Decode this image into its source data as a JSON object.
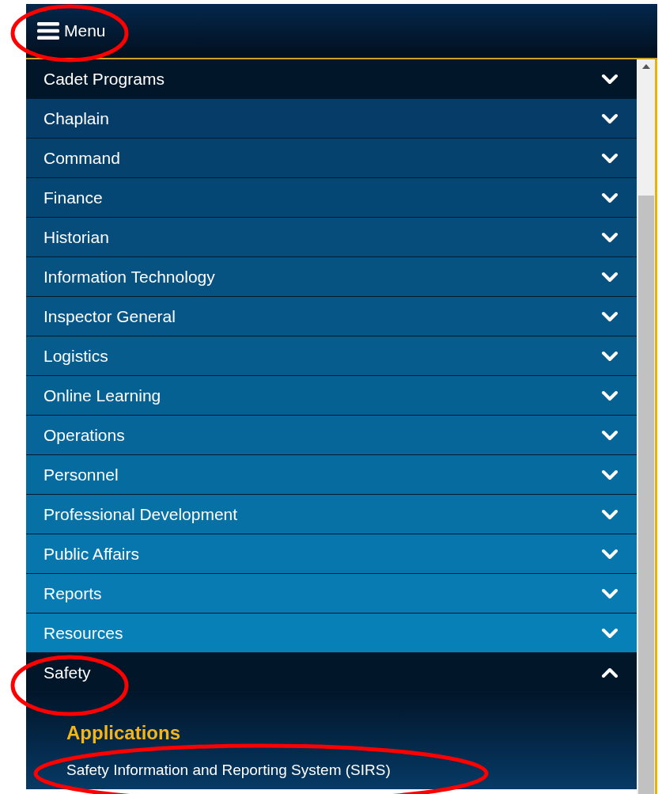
{
  "header": {
    "menu_label": "Menu"
  },
  "menu": {
    "items": [
      {
        "label": "Cadet Programs",
        "selected": true,
        "expanded": false
      },
      {
        "label": "Chaplain",
        "selected": false,
        "expanded": false
      },
      {
        "label": "Command",
        "selected": false,
        "expanded": false
      },
      {
        "label": "Finance",
        "selected": false,
        "expanded": false
      },
      {
        "label": "Historian",
        "selected": false,
        "expanded": false
      },
      {
        "label": "Information Technology",
        "selected": false,
        "expanded": false
      },
      {
        "label": "Inspector General",
        "selected": false,
        "expanded": false
      },
      {
        "label": "Logistics",
        "selected": false,
        "expanded": false
      },
      {
        "label": "Online Learning",
        "selected": false,
        "expanded": false
      },
      {
        "label": "Operations",
        "selected": false,
        "expanded": false
      },
      {
        "label": "Personnel",
        "selected": false,
        "expanded": false
      },
      {
        "label": "Professional Development",
        "selected": false,
        "expanded": false
      },
      {
        "label": "Public Affairs",
        "selected": false,
        "expanded": false
      },
      {
        "label": "Reports",
        "selected": false,
        "expanded": false
      },
      {
        "label": "Resources",
        "selected": false,
        "expanded": false
      },
      {
        "label": "Safety",
        "selected": true,
        "expanded": true,
        "submenu": {
          "heading": "Applications",
          "links": [
            "Safety Information and Reporting System (SIRS)"
          ]
        }
      }
    ]
  }
}
